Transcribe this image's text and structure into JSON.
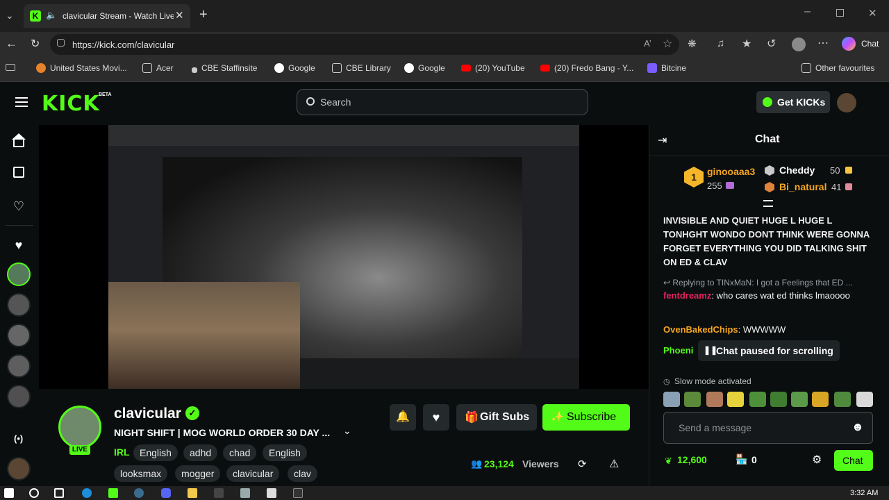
{
  "browser": {
    "tab_title": "clavicular Stream - Watch Live",
    "url": "https://kick.com/clavicular",
    "copilot_label": "Chat",
    "bookmarks": [
      "United States Movi...",
      "Acer",
      "CBE Staffinsite",
      "Google",
      "CBE Library",
      "Google",
      "(20) YouTube",
      "(20) Fredo Bang - Y...",
      "Bitcine"
    ],
    "other_favourites": "Other favourites"
  },
  "site": {
    "logo": "KICK",
    "beta": "BETA",
    "search_placeholder": "Search",
    "get_kicks": "Get KICKs"
  },
  "channel": {
    "name": "clavicular",
    "live_badge": "LIVE",
    "title": "NIGHT SHIFT | MOG WORLD ORDER 30 DAY ...",
    "category": "IRL",
    "tags": [
      "English",
      "adhd",
      "chad",
      "English"
    ],
    "tags_row2": [
      "looksmax",
      "mogger",
      "clavicular",
      "clav"
    ],
    "viewers_count": "23,124",
    "viewers_label": "Viewers",
    "gift_subs": "Gift Subs",
    "subscribe": "Subscribe"
  },
  "chat": {
    "header": "Chat",
    "leaderboard": {
      "first_name": "ginooaaa3",
      "first_count": "255",
      "second_name": "Cheddy",
      "second_count": "50",
      "third_name": "Bi_natural",
      "third_count": "41"
    },
    "message_1": "INVISIBLE AND QUIET HUGE L HUGE L TONHGHT WONDO DONT THINK WERE GONNA FORGET EVERYTHING YOU DID TALKING SHIT ON ED & CLAV",
    "reply_context": "Replying to TINxMaN: I got a Feelings that ED ...",
    "message_2_user": "fentdreamz",
    "message_2_text": "who cares wat ed thinks lmaoooo",
    "message_3_user": "OvenBakedChips",
    "message_3_text": "WWWWW",
    "message_4_user": "Phoeni",
    "paused_notice": "Chat paused for scrolling",
    "slow_mode": "Slow mode activated",
    "input_placeholder": "Send a message",
    "points": "12,600",
    "store_count": "0",
    "send_label": "Chat"
  },
  "taskbar": {
    "clock": "3:32 AM"
  },
  "colors": {
    "kick_green": "#53fc18",
    "bg": "#0b0e0f",
    "chat_red": "#e0245e",
    "chat_orange": "#f5a623"
  }
}
